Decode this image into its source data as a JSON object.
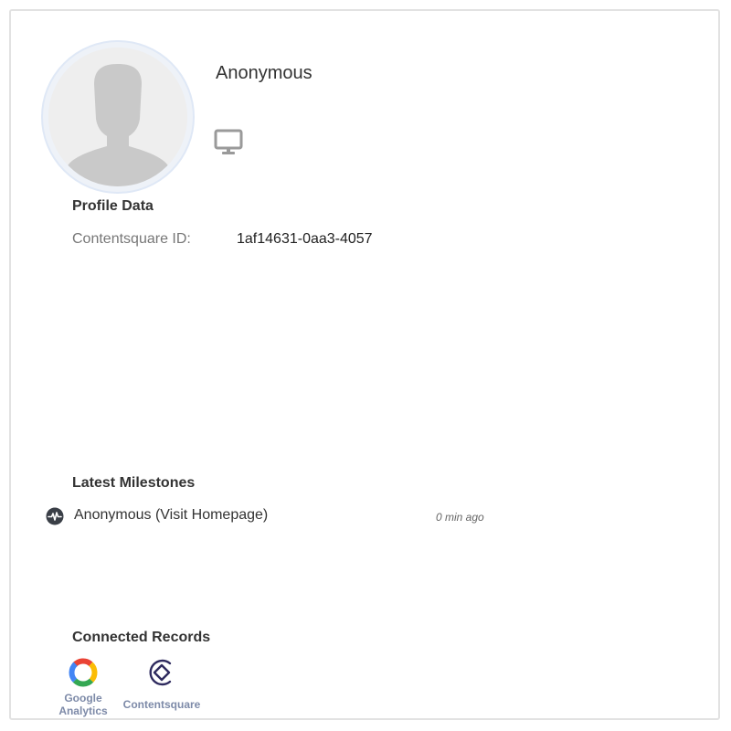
{
  "profile": {
    "name": "Anonymous",
    "device_icon": "desktop-monitor-icon",
    "avatar_icon": "default-user-avatar-icon"
  },
  "profile_data": {
    "title": "Profile Data",
    "fields": [
      {
        "key": "Contentsquare ID:",
        "value": "1af14631-0aa3-4057"
      }
    ]
  },
  "milestones": {
    "title": "Latest Milestones",
    "items": [
      {
        "icon": "activity-pulse-icon",
        "label": "Anonymous (Visit Homepage)",
        "time": "0 min ago"
      }
    ]
  },
  "connected_records": {
    "title": "Connected Records",
    "items": [
      {
        "icon": "google-analytics-icon",
        "label_line1": "Google",
        "label_line2": "Analytics"
      },
      {
        "icon": "contentsquare-icon",
        "label": "Contentsquare"
      }
    ]
  },
  "colors": {
    "border": "#e2e2e2",
    "text": "#333333",
    "muted": "#777777",
    "record_label": "#7d8aa8",
    "contentsquare_brand": "#2e2a5e"
  }
}
